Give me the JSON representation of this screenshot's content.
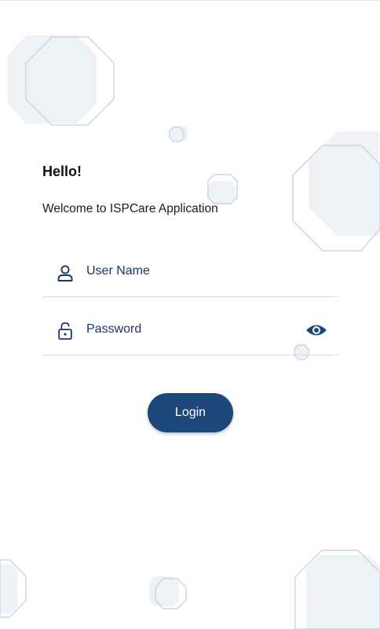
{
  "login": {
    "greeting": "Hello!",
    "welcome": "Welcome to ISPCare Application",
    "username_placeholder": "User Name",
    "password_placeholder": "Password",
    "login_label": "Login"
  },
  "icons": {
    "username": "user-icon",
    "password": "lock-icon",
    "toggle_visibility": "eye-icon"
  },
  "colors": {
    "accent": "#1b4879",
    "label": "#1a3567",
    "divider": "#d9dde3",
    "decor_fill": "#eef1f5",
    "decor_stroke": "#cbd6e4"
  }
}
